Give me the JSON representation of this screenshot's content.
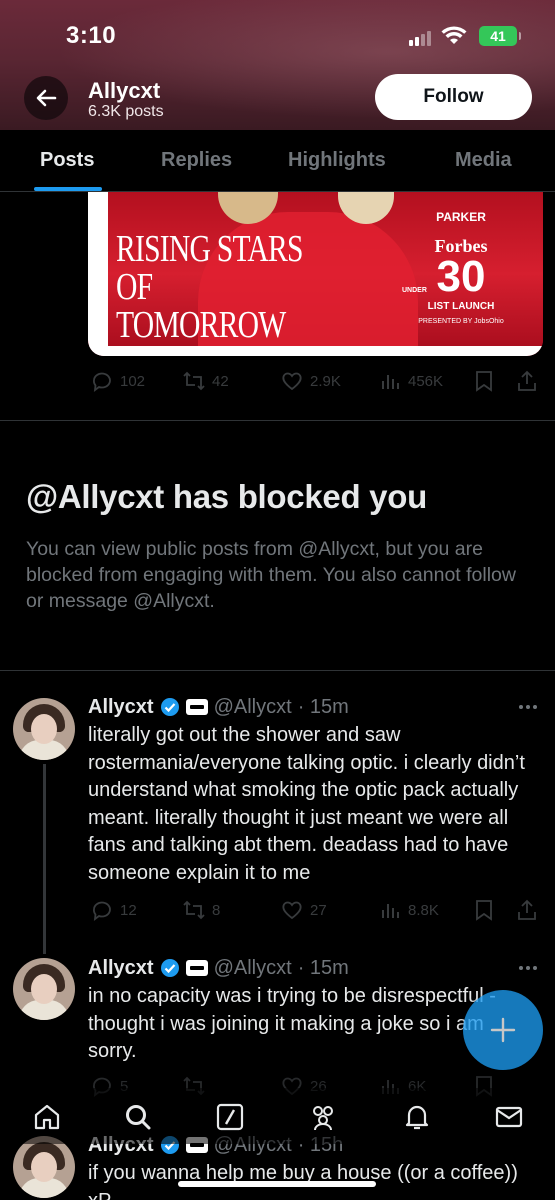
{
  "status_bar": {
    "time": "3:10",
    "battery": "41"
  },
  "header": {
    "name": "Allycxt",
    "posts_count": "6.3K posts",
    "follow_label": "Follow"
  },
  "tabs": [
    {
      "label": "Posts",
      "active": true
    },
    {
      "label": "Replies",
      "active": false
    },
    {
      "label": "Highlights",
      "active": false
    },
    {
      "label": "Media",
      "active": false
    }
  ],
  "media_card": {
    "headline": "RISING STARS OF TOMORROW",
    "parker": "PARKER",
    "brand": "Forbes",
    "under": "UNDER",
    "thirty": "30",
    "list_launch": "LIST LAUNCH",
    "presented_by": "PRESENTED BY JobsOhio"
  },
  "first_post_stats": {
    "replies": "102",
    "reposts": "42",
    "likes": "2.9K",
    "views": "456K"
  },
  "blocked": {
    "title": "@Allycxt has blocked you",
    "body": "You can view public posts from @Allycxt, but you are blocked from engaging with them. You also cannot follow or message @Allycxt."
  },
  "tweets": [
    {
      "name": "Allycxt",
      "handle": "@Allycxt",
      "time": "· 15m",
      "text": "literally got out the shower and saw rostermania/everyone talking optic. i clearly didn’t understand what smoking the optic pack actually meant. literally thought it just meant we were all fans and talking abt them. deadass had to have someone explain it to me",
      "replies": "12",
      "reposts": "8",
      "likes": "27",
      "views": "8.8K"
    },
    {
      "name": "Allycxt",
      "handle": "@Allycxt",
      "time": "· 15m",
      "text": "in no capacity was i trying to be disrespectful - thought i was joining it making a joke so i am sorry.",
      "replies": "5",
      "reposts": "",
      "likes": "26",
      "views": "6K"
    },
    {
      "name": "Allycxt",
      "handle": "@Allycxt",
      "time": "· 15h",
      "text": "if you wanna help me buy a house ((or a coffee)) xP"
    }
  ],
  "colors": {
    "accent": "#1d9bf0",
    "muted": "#71767b",
    "text": "#e7e9ea",
    "battery": "#34c759"
  },
  "icons": [
    "back-arrow-icon",
    "verified-icon",
    "reply-icon",
    "repost-icon",
    "like-icon",
    "views-icon",
    "bookmark-icon",
    "share-icon",
    "more-icon",
    "home-icon",
    "search-icon",
    "grok-icon",
    "communities-icon",
    "notifications-icon",
    "messages-icon",
    "compose-icon"
  ]
}
